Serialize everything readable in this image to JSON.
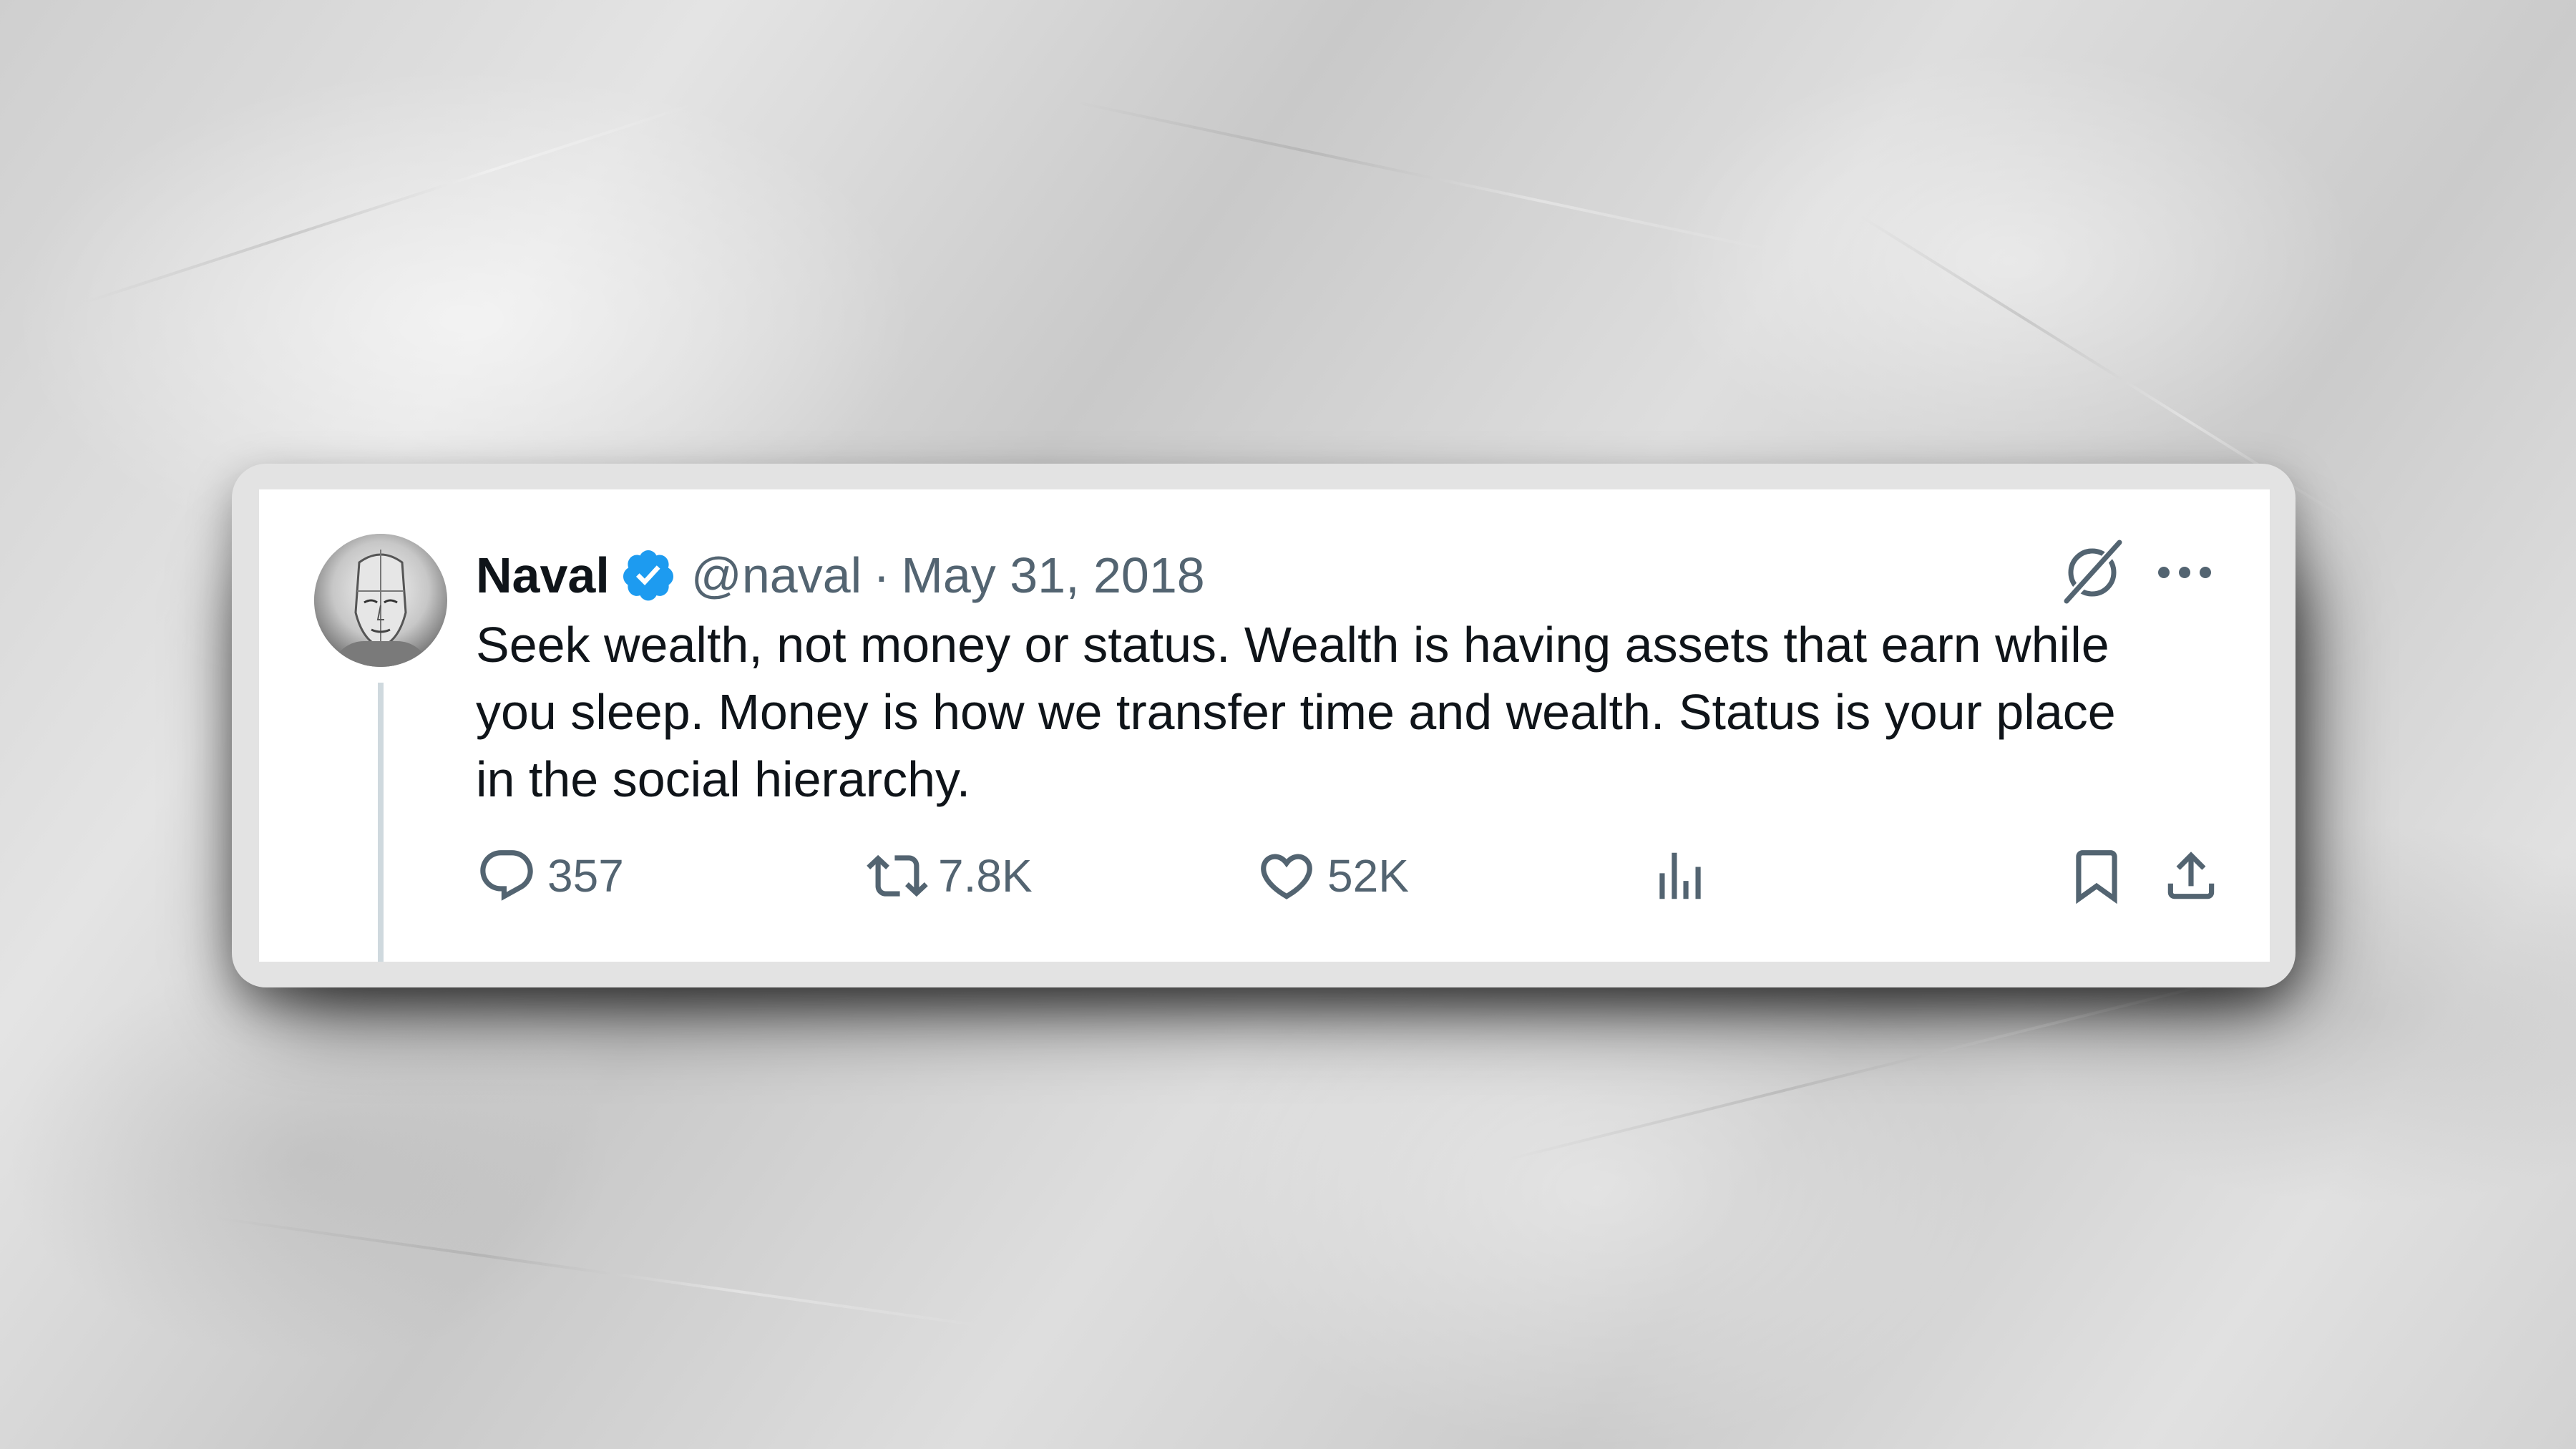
{
  "tweet": {
    "author_name": "Naval",
    "handle": "@naval",
    "separator": "·",
    "date": "May 31, 2018",
    "text": "Seek wealth, not money or status. Wealth is having assets that earn while\nyou sleep. Money is how we transfer time and wealth. Status is your place\nin the social hierarchy.",
    "verified_color": "#1d9bf0"
  },
  "actions": {
    "reply_count": "357",
    "retweet_count": "7.8K",
    "like_count": "52K"
  },
  "icons": {
    "verified": "verified-badge-icon",
    "grok": "grok-icon",
    "more": "more-icon",
    "reply": "reply-icon",
    "retweet": "retweet-icon",
    "like": "heart-icon",
    "views": "views-chart-icon",
    "bookmark": "bookmark-icon",
    "share": "share-icon"
  },
  "colors": {
    "text_primary": "#0f1419",
    "text_secondary": "#536471",
    "thread_line": "#cfd9de"
  }
}
